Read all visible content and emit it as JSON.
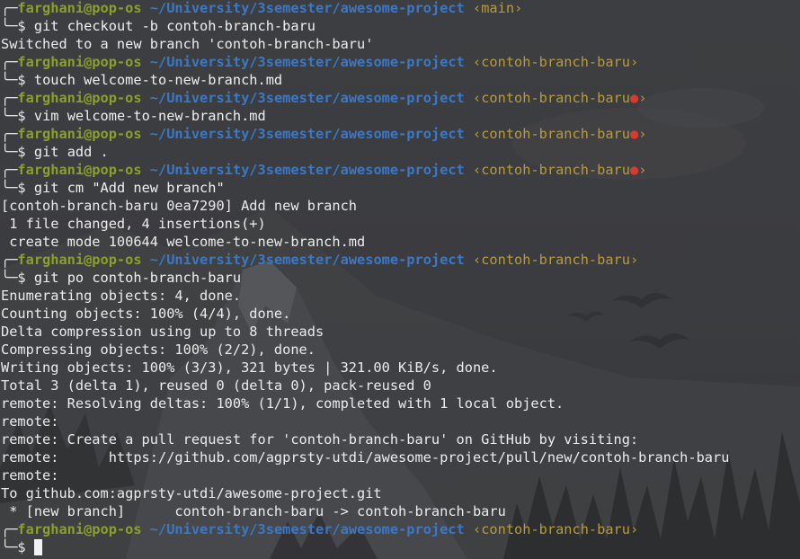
{
  "prompt": {
    "user_host": "farghani@pop-os",
    "cwd": "~/University/3semester/awesome-project",
    "corner_top": "╭─",
    "corner_bottom": "╰─$",
    "dirty_mark": "●"
  },
  "lines": [
    {
      "type": "prompt",
      "branch": "‹main›",
      "dirty": false
    },
    {
      "type": "cmd",
      "text": "git checkout -b contoh-branch-baru"
    },
    {
      "type": "out",
      "text": "Switched to a new branch 'contoh-branch-baru'"
    },
    {
      "type": "prompt",
      "branch": "‹contoh-branch-baru›",
      "dirty": false
    },
    {
      "type": "cmd",
      "text": "touch welcome-to-new-branch.md"
    },
    {
      "type": "prompt",
      "branch": "‹contoh-branch-baru",
      "dirty": true
    },
    {
      "type": "cmd",
      "text": "vim welcome-to-new-branch.md"
    },
    {
      "type": "prompt",
      "branch": "‹contoh-branch-baru",
      "dirty": true
    },
    {
      "type": "cmd",
      "text": "git add ."
    },
    {
      "type": "prompt",
      "branch": "‹contoh-branch-baru",
      "dirty": true
    },
    {
      "type": "cmd",
      "text": "git cm \"Add new branch\""
    },
    {
      "type": "out",
      "text": "[contoh-branch-baru 0ea7290] Add new branch"
    },
    {
      "type": "out",
      "text": " 1 file changed, 4 insertions(+)"
    },
    {
      "type": "out",
      "text": " create mode 100644 welcome-to-new-branch.md"
    },
    {
      "type": "prompt",
      "branch": "‹contoh-branch-baru›",
      "dirty": false
    },
    {
      "type": "cmd",
      "text": "git po contoh-branch-baru"
    },
    {
      "type": "out",
      "text": "Enumerating objects: 4, done."
    },
    {
      "type": "out",
      "text": "Counting objects: 100% (4/4), done."
    },
    {
      "type": "out",
      "text": "Delta compression using up to 8 threads"
    },
    {
      "type": "out",
      "text": "Compressing objects: 100% (2/2), done."
    },
    {
      "type": "out",
      "text": "Writing objects: 100% (3/3), 321 bytes | 321.00 KiB/s, done."
    },
    {
      "type": "out",
      "text": "Total 3 (delta 1), reused 0 (delta 0), pack-reused 0"
    },
    {
      "type": "out",
      "text": "remote: Resolving deltas: 100% (1/1), completed with 1 local object."
    },
    {
      "type": "out",
      "text": "remote:"
    },
    {
      "type": "out",
      "text": "remote: Create a pull request for 'contoh-branch-baru' on GitHub by visiting:"
    },
    {
      "type": "out",
      "text": "remote:      https://github.com/agprsty-utdi/awesome-project/pull/new/contoh-branch-baru"
    },
    {
      "type": "out",
      "text": "remote:"
    },
    {
      "type": "out",
      "text": "To github.com:agprsty-utdi/awesome-project.git"
    },
    {
      "type": "out",
      "text": " * [new branch]      contoh-branch-baru -> contoh-branch-baru"
    },
    {
      "type": "prompt",
      "branch": "‹contoh-branch-baru›",
      "dirty": false
    },
    {
      "type": "input",
      "text": ""
    }
  ],
  "colors": {
    "user": "#8c9f2c",
    "cwd": "#3a78c8",
    "branch": "#b89b3b",
    "dirty": "#d83a2f",
    "text": "#ececec",
    "background": "#3a3b3e"
  }
}
